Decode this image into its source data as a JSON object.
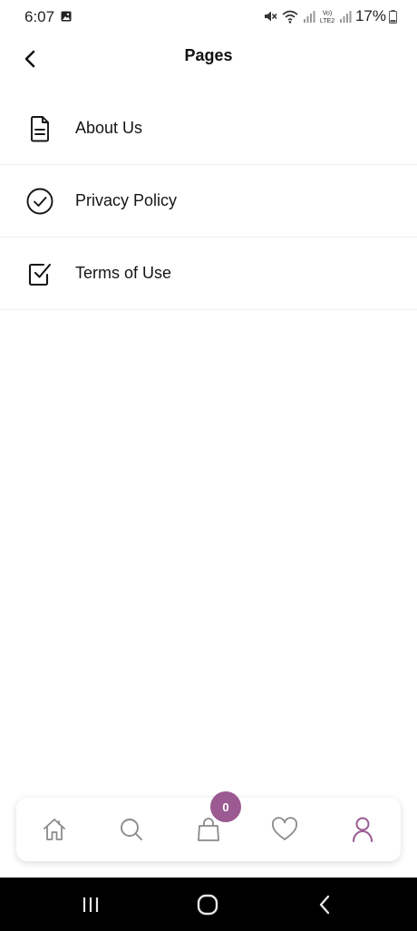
{
  "status_bar": {
    "time": "6:07",
    "battery": "17%",
    "network_label": "Vo) LTE2"
  },
  "header": {
    "title": "Pages"
  },
  "menu": {
    "items": [
      {
        "label": "About Us",
        "icon": "document-icon"
      },
      {
        "label": "Privacy Policy",
        "icon": "check-circle-icon"
      },
      {
        "label": "Terms of Use",
        "icon": "checkbox-checked-icon"
      }
    ]
  },
  "tab_bar": {
    "cart_count": "0",
    "tabs": [
      "home-icon",
      "search-icon",
      "shopping-bag-icon",
      "heart-icon",
      "user-icon"
    ],
    "active_tab": "user-icon"
  },
  "colors": {
    "accent": "#9b5a91",
    "icon_gray": "#8a8a8a",
    "text": "#111111"
  }
}
